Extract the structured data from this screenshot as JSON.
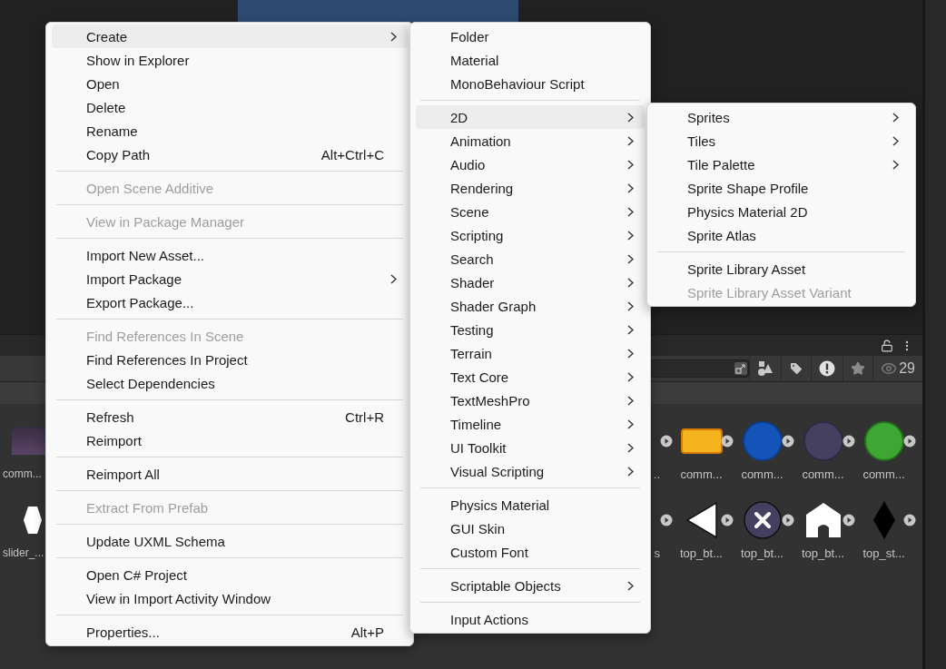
{
  "project_panel": {
    "result_count": "29",
    "rows": [
      {
        "tiles": [
          {
            "kind": "purple_bar",
            "label": "comm..."
          },
          {
            "kind": "partial",
            "label": ".."
          },
          {
            "kind": "yellow_bar",
            "label": "comm..."
          },
          {
            "kind": "blue_circle",
            "label": "comm..."
          },
          {
            "kind": "purple_circle",
            "label": "comm..."
          },
          {
            "kind": "green_circle",
            "label": "comm..."
          }
        ]
      },
      {
        "tiles": [
          {
            "kind": "hexagon",
            "label": "slider_..."
          },
          {
            "kind": "partial",
            "label": "s"
          },
          {
            "kind": "triangle",
            "label": "top_bt..."
          },
          {
            "kind": "close_circle",
            "label": "top_bt..."
          },
          {
            "kind": "house",
            "label": "top_bt..."
          },
          {
            "kind": "diamond",
            "label": "top_st..."
          }
        ]
      }
    ]
  },
  "context_menu": {
    "items": [
      {
        "kind": "item",
        "label": "Create",
        "has_submenu": true,
        "selected": true,
        "disabled": false
      },
      {
        "kind": "item",
        "label": "Show in Explorer",
        "has_submenu": false,
        "selected": false,
        "disabled": false
      },
      {
        "kind": "item",
        "label": "Open",
        "has_submenu": false,
        "selected": false,
        "disabled": false
      },
      {
        "kind": "item",
        "label": "Delete",
        "has_submenu": false,
        "selected": false,
        "disabled": false
      },
      {
        "kind": "item",
        "label": "Rename",
        "has_submenu": false,
        "selected": false,
        "disabled": false
      },
      {
        "kind": "item",
        "label": "Copy Path",
        "shortcut": "Alt+Ctrl+C",
        "has_submenu": false,
        "selected": false,
        "disabled": false
      },
      {
        "kind": "separator"
      },
      {
        "kind": "item",
        "label": "Open Scene Additive",
        "has_submenu": false,
        "selected": false,
        "disabled": true
      },
      {
        "kind": "separator"
      },
      {
        "kind": "item",
        "label": "View in Package Manager",
        "has_submenu": false,
        "selected": false,
        "disabled": true
      },
      {
        "kind": "separator"
      },
      {
        "kind": "item",
        "label": "Import New Asset...",
        "has_submenu": false,
        "selected": false,
        "disabled": false
      },
      {
        "kind": "item",
        "label": "Import Package",
        "has_submenu": true,
        "selected": false,
        "disabled": false
      },
      {
        "kind": "item",
        "label": "Export Package...",
        "has_submenu": false,
        "selected": false,
        "disabled": false
      },
      {
        "kind": "separator"
      },
      {
        "kind": "item",
        "label": "Find References In Scene",
        "has_submenu": false,
        "selected": false,
        "disabled": true
      },
      {
        "kind": "item",
        "label": "Find References In Project",
        "has_submenu": false,
        "selected": false,
        "disabled": false
      },
      {
        "kind": "item",
        "label": "Select Dependencies",
        "has_submenu": false,
        "selected": false,
        "disabled": false
      },
      {
        "kind": "separator"
      },
      {
        "kind": "item",
        "label": "Refresh",
        "shortcut": "Ctrl+R",
        "has_submenu": false,
        "selected": false,
        "disabled": false
      },
      {
        "kind": "item",
        "label": "Reimport",
        "has_submenu": false,
        "selected": false,
        "disabled": false
      },
      {
        "kind": "separator"
      },
      {
        "kind": "item",
        "label": "Reimport All",
        "has_submenu": false,
        "selected": false,
        "disabled": false
      },
      {
        "kind": "separator"
      },
      {
        "kind": "item",
        "label": "Extract From Prefab",
        "has_submenu": false,
        "selected": false,
        "disabled": true
      },
      {
        "kind": "separator"
      },
      {
        "kind": "item",
        "label": "Update UXML Schema",
        "has_submenu": false,
        "selected": false,
        "disabled": false
      },
      {
        "kind": "separator"
      },
      {
        "kind": "item",
        "label": "Open C# Project",
        "has_submenu": false,
        "selected": false,
        "disabled": false
      },
      {
        "kind": "item",
        "label": "View in Import Activity Window",
        "has_submenu": false,
        "selected": false,
        "disabled": false
      },
      {
        "kind": "separator"
      },
      {
        "kind": "item",
        "label": "Properties...",
        "shortcut": "Alt+P",
        "has_submenu": false,
        "selected": false,
        "disabled": false
      }
    ]
  },
  "create_submenu": {
    "items": [
      {
        "kind": "item",
        "label": "Folder",
        "has_submenu": false,
        "selected": false,
        "disabled": false
      },
      {
        "kind": "item",
        "label": "Material",
        "has_submenu": false,
        "selected": false,
        "disabled": false
      },
      {
        "kind": "item",
        "label": "MonoBehaviour Script",
        "has_submenu": false,
        "selected": false,
        "disabled": false
      },
      {
        "kind": "separator"
      },
      {
        "kind": "item",
        "label": "2D",
        "has_submenu": true,
        "selected": true,
        "disabled": false
      },
      {
        "kind": "item",
        "label": "Animation",
        "has_submenu": true,
        "selected": false,
        "disabled": false
      },
      {
        "kind": "item",
        "label": "Audio",
        "has_submenu": true,
        "selected": false,
        "disabled": false
      },
      {
        "kind": "item",
        "label": "Rendering",
        "has_submenu": true,
        "selected": false,
        "disabled": false
      },
      {
        "kind": "item",
        "label": "Scene",
        "has_submenu": true,
        "selected": false,
        "disabled": false
      },
      {
        "kind": "item",
        "label": "Scripting",
        "has_submenu": true,
        "selected": false,
        "disabled": false
      },
      {
        "kind": "item",
        "label": "Search",
        "has_submenu": true,
        "selected": false,
        "disabled": false
      },
      {
        "kind": "item",
        "label": "Shader",
        "has_submenu": true,
        "selected": false,
        "disabled": false
      },
      {
        "kind": "item",
        "label": "Shader Graph",
        "has_submenu": true,
        "selected": false,
        "disabled": false
      },
      {
        "kind": "item",
        "label": "Testing",
        "has_submenu": true,
        "selected": false,
        "disabled": false
      },
      {
        "kind": "item",
        "label": "Terrain",
        "has_submenu": true,
        "selected": false,
        "disabled": false
      },
      {
        "kind": "item",
        "label": "Text Core",
        "has_submenu": true,
        "selected": false,
        "disabled": false
      },
      {
        "kind": "item",
        "label": "TextMeshPro",
        "has_submenu": true,
        "selected": false,
        "disabled": false
      },
      {
        "kind": "item",
        "label": "Timeline",
        "has_submenu": true,
        "selected": false,
        "disabled": false
      },
      {
        "kind": "item",
        "label": "UI Toolkit",
        "has_submenu": true,
        "selected": false,
        "disabled": false
      },
      {
        "kind": "item",
        "label": "Visual Scripting",
        "has_submenu": true,
        "selected": false,
        "disabled": false
      },
      {
        "kind": "separator"
      },
      {
        "kind": "item",
        "label": "Physics Material",
        "has_submenu": false,
        "selected": false,
        "disabled": false
      },
      {
        "kind": "item",
        "label": "GUI Skin",
        "has_submenu": false,
        "selected": false,
        "disabled": false
      },
      {
        "kind": "item",
        "label": "Custom Font",
        "has_submenu": false,
        "selected": false,
        "disabled": false
      },
      {
        "kind": "separator"
      },
      {
        "kind": "item",
        "label": "Scriptable Objects",
        "has_submenu": true,
        "selected": false,
        "disabled": false
      },
      {
        "kind": "separator"
      },
      {
        "kind": "item",
        "label": "Input Actions",
        "has_submenu": false,
        "selected": false,
        "disabled": false
      }
    ]
  },
  "2d_submenu": {
    "items": [
      {
        "kind": "item",
        "label": "Sprites",
        "has_submenu": true,
        "selected": false,
        "disabled": false
      },
      {
        "kind": "item",
        "label": "Tiles",
        "has_submenu": true,
        "selected": false,
        "disabled": false
      },
      {
        "kind": "item",
        "label": "Tile Palette",
        "has_submenu": true,
        "selected": false,
        "disabled": false
      },
      {
        "kind": "item",
        "label": "Sprite Shape Profile",
        "has_submenu": false,
        "selected": false,
        "disabled": false
      },
      {
        "kind": "item",
        "label": "Physics Material 2D",
        "has_submenu": false,
        "selected": false,
        "disabled": false
      },
      {
        "kind": "item",
        "label": "Sprite Atlas",
        "has_submenu": false,
        "selected": false,
        "disabled": false
      },
      {
        "kind": "separator"
      },
      {
        "kind": "item",
        "label": "Sprite Library Asset",
        "has_submenu": false,
        "selected": false,
        "disabled": false
      },
      {
        "kind": "item",
        "label": "Sprite Library Asset Variant",
        "has_submenu": false,
        "selected": false,
        "disabled": true
      }
    ]
  }
}
